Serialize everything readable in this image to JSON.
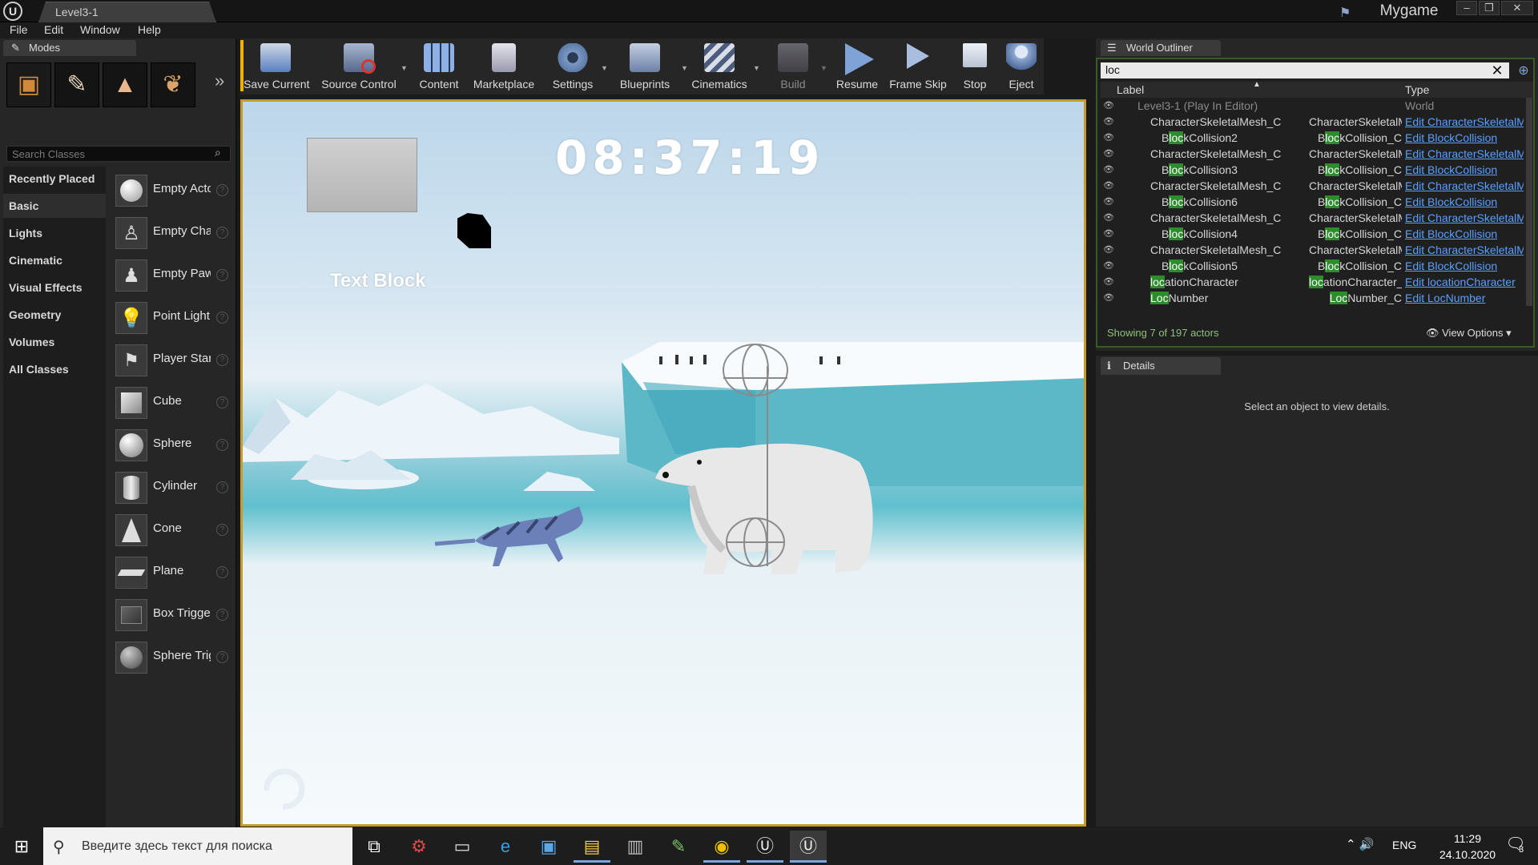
{
  "window": {
    "doc_tab": "Level3-1",
    "project": "Mygame",
    "controls": [
      "–",
      "❐",
      "✕"
    ]
  },
  "menu": [
    "File",
    "Edit",
    "Window",
    "Help"
  ],
  "modes_panel": {
    "tab_label": "Modes",
    "search_placeholder": "Search Classes",
    "categories": [
      "Recently Placed",
      "Basic",
      "Lights",
      "Cinematic",
      "Visual Effects",
      "Geometry",
      "Volumes",
      "All Classes"
    ],
    "selected_category": "Basic",
    "items": [
      {
        "label": "Empty Actor",
        "icon": "sphere-icon"
      },
      {
        "label": "Empty Character",
        "icon": "mannequin-icon"
      },
      {
        "label": "Empty Pawn",
        "icon": "pawn-icon"
      },
      {
        "label": "Point Light",
        "icon": "bulb-icon"
      },
      {
        "label": "Player Start",
        "icon": "flag-icon"
      },
      {
        "label": "Cube",
        "icon": "cube-icon"
      },
      {
        "label": "Sphere",
        "icon": "sphere-icon"
      },
      {
        "label": "Cylinder",
        "icon": "cylinder-icon"
      },
      {
        "label": "Cone",
        "icon": "cone-icon"
      },
      {
        "label": "Plane",
        "icon": "plane-icon"
      },
      {
        "label": "Box Trigger",
        "icon": "box-trigger-icon"
      },
      {
        "label": "Sphere Trigger",
        "icon": "sphere-trigger-icon"
      }
    ]
  },
  "toolbar": {
    "buttons": [
      {
        "label": "Save Current",
        "color": "#5a7fc0"
      },
      {
        "label": "Source Control",
        "color": "#7a8fb8"
      },
      {
        "label": "Content",
        "color": "#6f96d6"
      },
      {
        "label": "Marketplace",
        "color": "#b8b8c8"
      },
      {
        "label": "Settings",
        "color": "#5d7ba8"
      },
      {
        "label": "Blueprints",
        "color": "#8a9dc2"
      },
      {
        "label": "Cinematics",
        "color": "#8a9dc2"
      },
      {
        "label": "Build",
        "color": "#6e6e78"
      },
      {
        "label": "Resume",
        "color": "#7fa3d6"
      },
      {
        "label": "Frame Skip",
        "color": "#9fb5d6"
      },
      {
        "label": "Stop",
        "color": "#b8c2d2"
      },
      {
        "label": "Eject",
        "color": "#8fa8d0"
      }
    ]
  },
  "viewport": {
    "clock": "08:37:19",
    "text_block": "Text Block"
  },
  "outliner": {
    "tab_label": "World Outliner",
    "search_value": "loc",
    "col_label": "Label",
    "col_type": "Type",
    "rows": [
      {
        "label": "Level3-1 (Play In Editor)",
        "type": "World",
        "edit": ""
      },
      {
        "label": "CharacterSkeletalMesh_C",
        "type": "CharacterSkeletalMesh_C",
        "edit": "Edit CharacterSkeletalMesh"
      },
      {
        "label": "BlockCollision2",
        "type": "BlockCollision_C",
        "edit": "Edit BlockCollision"
      },
      {
        "label": "CharacterSkeletalMesh_C",
        "type": "CharacterSkeletalMesh_C",
        "edit": "Edit CharacterSkeletalMesh"
      },
      {
        "label": "BlockCollision3",
        "type": "BlockCollision_C",
        "edit": "Edit BlockCollision"
      },
      {
        "label": "CharacterSkeletalMesh_C",
        "type": "CharacterSkeletalMesh_C",
        "edit": "Edit CharacterSkeletalMesh"
      },
      {
        "label": "BlockCollision6",
        "type": "BlockCollision_C",
        "edit": "Edit BlockCollision"
      },
      {
        "label": "CharacterSkeletalMesh_C",
        "type": "CharacterSkeletalMesh_C",
        "edit": "Edit CharacterSkeletalMesh"
      },
      {
        "label": "BlockCollision4",
        "type": "BlockCollision_C",
        "edit": "Edit BlockCollision"
      },
      {
        "label": "CharacterSkeletalMesh_C",
        "type": "CharacterSkeletalMesh_C",
        "edit": "Edit CharacterSkeletalMesh"
      },
      {
        "label": "BlockCollision5",
        "type": "BlockCollision_C",
        "edit": "Edit BlockCollision"
      },
      {
        "label": "locationCharacter",
        "type": "locationCharacter_C",
        "edit": "Edit locationCharacter"
      },
      {
        "label": "LocNumber",
        "type": "LocNumber_C",
        "edit": "Edit LocNumber"
      }
    ],
    "status": "Showing 7 of 197 actors",
    "view_options": "View Options"
  },
  "details": {
    "tab_label": "Details",
    "empty_message": "Select an object to view details."
  },
  "taskbar": {
    "search_placeholder": "Введите здесь текст для поиска",
    "language": "ENG",
    "time": "11:29",
    "date": "24.10.2020",
    "notifications": "3"
  }
}
